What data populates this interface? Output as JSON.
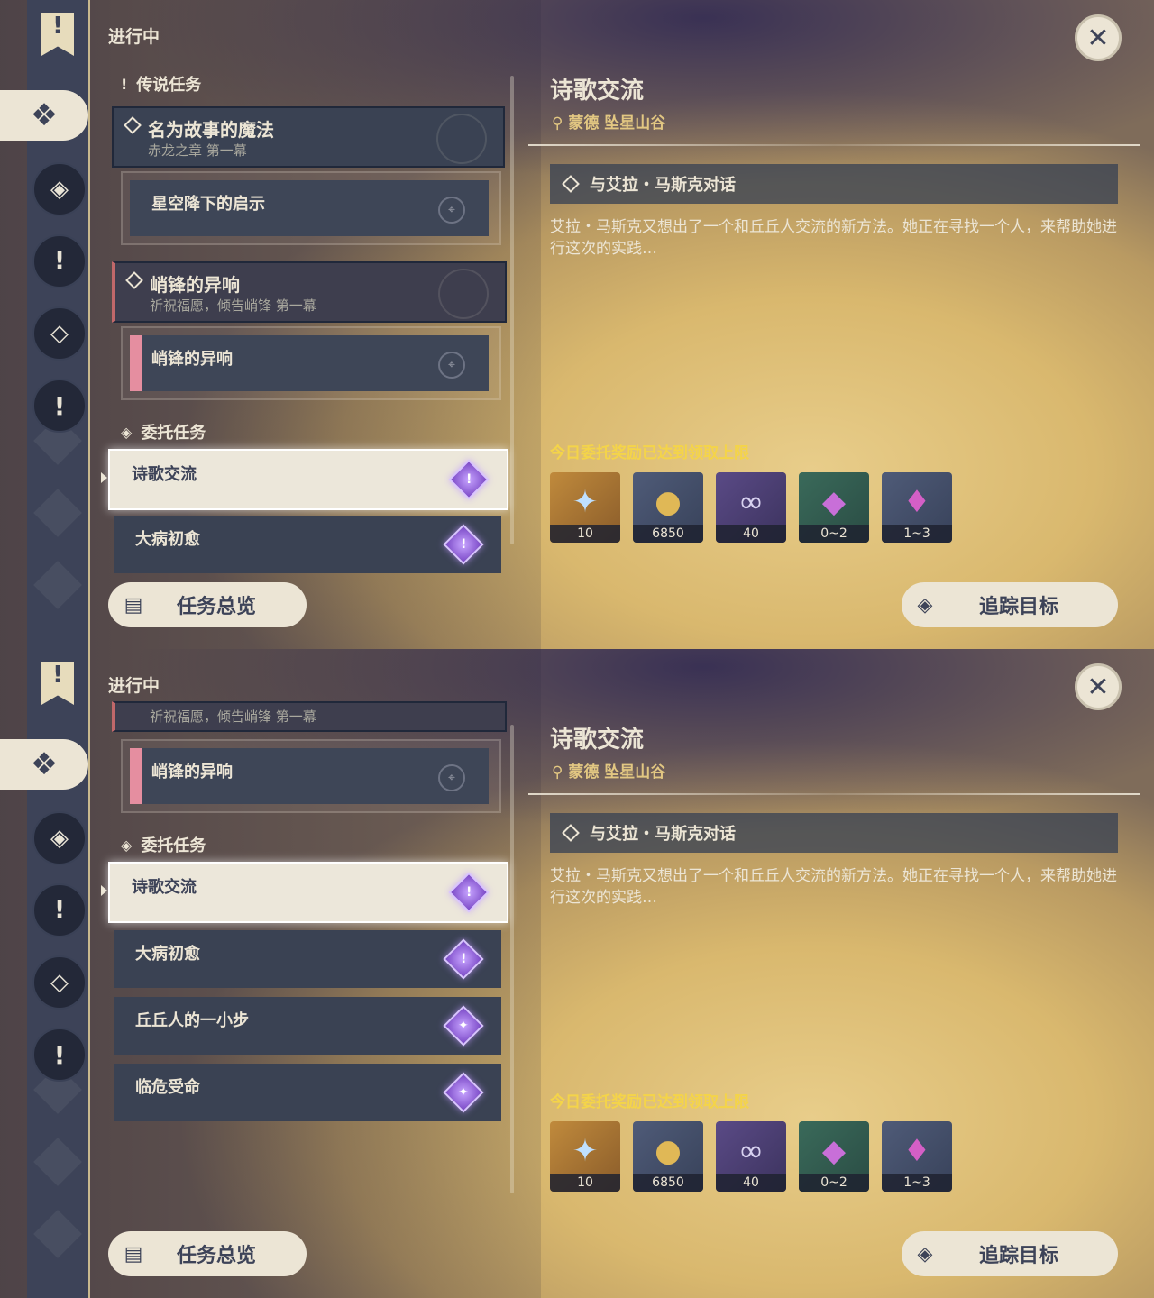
{
  "screens": [
    {
      "status": "进行中",
      "legend_section": "传说任务",
      "legend_quests": [
        {
          "title": "名为故事的魔法",
          "subtitle": "赤龙之章 第一幕",
          "step": "星空降下的启示"
        },
        {
          "title": "峭锋的异响",
          "subtitle": "祈祝福愿，倾告峭锋 第一幕",
          "step": "峭锋的异响"
        }
      ],
      "commission_section": "委托任务",
      "commissions": [
        "诗歌交流",
        "大病初愈"
      ],
      "overview_button": "任务总览",
      "track_button": "追踪目标"
    },
    {
      "status": "进行中",
      "partial_subtitle": "祈祝福愿，倾告峭锋 第一幕",
      "partial_step": "峭锋的异响",
      "commission_section": "委托任务",
      "commissions": [
        "诗歌交流",
        "大病初愈",
        "丘丘人的一小步",
        "临危受命"
      ],
      "overview_button": "任务总览",
      "track_button": "追踪目标"
    }
  ],
  "detail": {
    "title": "诗歌交流",
    "location": "蒙德 坠星山谷",
    "objective": "与艾拉・马斯克对话",
    "description": "艾拉・马斯克又想出了一个和丘丘人交流的新方法。她正在寻找一个人，来帮助她进行这次的实践…",
    "reward_limit": "今日委托奖励已达到领取上限",
    "rewards": [
      {
        "icon": "primogem-icon",
        "count": "10"
      },
      {
        "icon": "mora-icon",
        "count": "6850"
      },
      {
        "icon": "friendship-exp-icon",
        "count": "40"
      },
      {
        "icon": "crystal-chunk-icon",
        "count": "0~2"
      },
      {
        "icon": "crystal-cluster-icon",
        "count": "1~3"
      }
    ]
  },
  "colors": {
    "accent_gold": "#f4d449",
    "location": "#e2c782",
    "selected_card": "#ece7da",
    "card": "#3a4253"
  }
}
